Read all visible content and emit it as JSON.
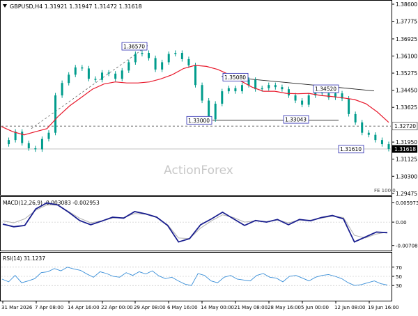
{
  "header": {
    "title": "GBPUSD,H4  1.31921 1.31947 1.31472 1.31618",
    "watermark": "ActionForex",
    "fe_label": "FE 100.0"
  },
  "colors": {
    "candle": "#009c8c",
    "ma": "#e8192c",
    "macd_line": "#1a1f8f",
    "macd_signal": "#b0b0b0",
    "rsi": "#3a8fd8",
    "trendline": "#222222",
    "dashed_trend": "#666666",
    "current_box": "#000000",
    "ref_box": "#555555",
    "level_box_border": "#2a2ab0",
    "grid": "#d8d8d8"
  },
  "chart_data": [
    {
      "type": "line",
      "name": "price",
      "title": "GBPUSD,H4  1.31921 1.31947 1.31472 1.31618",
      "ylim": [
        1.2947,
        1.386
      ],
      "yticks": [
        "1.38600",
        "1.37775",
        "1.36925",
        "1.36100",
        "1.35275",
        "1.34450",
        "1.33625",
        "1.32800",
        "1.31950",
        "1.31125",
        "1.30300",
        "1.29475"
      ],
      "x": [
        "31 Mar 2026",
        "7 Apr 08:00",
        "14 Apr 16:00",
        "22 Apr 00:00",
        "29 Apr 08:00",
        "6 May 16:00",
        "14 May 00:00",
        "21 May 08:00",
        "28 May 16:00",
        "5 Jun 00:00",
        "12 Jun 08:00",
        "19 Jun 16:00"
      ],
      "series": [
        {
          "values": [
            1.3185,
            1.3205,
            1.3245,
            1.319,
            1.3165,
            1.316,
            1.321,
            1.324,
            1.342,
            1.348,
            1.352,
            1.3555,
            1.355,
            1.35,
            1.3495,
            1.353,
            1.3525,
            1.35,
            1.354,
            1.358,
            1.362,
            1.3625,
            1.36,
            1.3545,
            1.358,
            1.362,
            1.3625,
            1.3595,
            1.3565,
            1.347,
            1.3395,
            1.3305,
            1.338,
            1.344,
            1.3455,
            1.344,
            1.347,
            1.3495,
            1.345,
            1.3455,
            1.347,
            1.346,
            1.345,
            1.342,
            1.3395,
            1.3375,
            1.342,
            1.345,
            1.343,
            1.341,
            1.343,
            1.3405,
            1.333,
            1.329,
            1.324,
            1.323,
            1.3205,
            1.3185,
            1.3162
          ]
        },
        {
          "values": [
            1.327,
            1.3245,
            1.323,
            1.3245,
            1.326,
            1.332,
            1.337,
            1.341,
            1.345,
            1.3475,
            1.3485,
            1.348,
            1.348,
            1.3485,
            1.35,
            1.352,
            1.355,
            1.3565,
            1.356,
            1.3545,
            1.352,
            1.349,
            1.346,
            1.344,
            1.344,
            1.343,
            1.3428,
            1.343,
            1.342,
            1.3415,
            1.3408,
            1.34,
            1.338,
            1.334,
            1.329
          ]
        }
      ],
      "annotations": [
        {
          "label": "1.36570",
          "value": 1.3657
        },
        {
          "label": "1.35080",
          "value": 1.3508
        },
        {
          "label": "1.34520",
          "value": 1.3452
        },
        {
          "label": "1.33000",
          "value": 1.33
        },
        {
          "label": "1.33043",
          "value": 1.33043
        },
        {
          "label": "1.31610",
          "value": 1.3161
        }
      ],
      "reference_levels": [
        {
          "label": "1.32720",
          "value": 1.3272,
          "style": "dashed"
        }
      ],
      "current_price": {
        "label": "1.31618",
        "value": 1.31618
      }
    },
    {
      "type": "line",
      "name": "macd",
      "title": "MACD(12,26,9) -0.003083 -0.002953",
      "ylim": [
        -0.0082,
        0.0072
      ],
      "yticks": [
        "0.005973",
        "0.00",
        "-0.007086"
      ],
      "series": [
        {
          "values": [
            -0.0006,
            -0.0014,
            -0.001,
            0.004,
            0.0058,
            0.0052,
            0.003,
            0.0005,
            -0.0008,
            0.0003,
            0.0015,
            0.0012,
            0.0032,
            0.0025,
            0.0015,
            -0.001,
            -0.006,
            -0.005,
            -0.0008,
            0.001,
            0.003,
            0.001,
            -0.001,
            0.0005,
            0.0,
            0.0008,
            -0.0008,
            0.0008,
            0.0004,
            0.0014,
            0.002,
            0.001,
            -0.006,
            -0.0045,
            -0.003,
            -0.0032
          ]
        },
        {
          "values": [
            0.0004,
            -0.0002,
            0.001,
            0.0036,
            0.0052,
            0.0052,
            0.0032,
            0.0012,
            -0.0002,
            0.0004,
            0.0012,
            0.0014,
            0.0026,
            0.0024,
            0.0014,
            -0.0008,
            -0.0048,
            -0.005,
            -0.0018,
            0.0004,
            0.0022,
            0.0014,
            0.0,
            0.0004,
            0.0002,
            0.0006,
            -0.0002,
            0.0006,
            0.0006,
            0.0012,
            0.0018,
            0.0014,
            -0.004,
            -0.0048,
            -0.0036,
            -0.003
          ]
        }
      ]
    },
    {
      "type": "line",
      "name": "rsi",
      "title": "RSI(14) 31.1237",
      "ylim": [
        0,
        100
      ],
      "yticks": [
        "70",
        "50",
        "30"
      ],
      "series": [
        {
          "values": [
            44,
            38,
            52,
            36,
            40,
            45,
            58,
            60,
            67,
            62,
            70,
            66,
            63,
            55,
            48,
            60,
            56,
            50,
            48,
            58,
            52,
            60,
            55,
            62,
            51,
            45,
            48,
            40,
            33,
            30,
            56,
            52,
            40,
            36,
            48,
            52,
            44,
            42,
            40,
            52,
            56,
            48,
            46,
            38,
            50,
            52,
            46,
            40,
            48,
            52,
            54,
            50,
            45,
            36,
            30,
            32,
            36,
            40,
            34,
            31
          ]
        }
      ]
    }
  ],
  "x_axis": {
    "labels": [
      "31 Mar 2026",
      "7 Apr 08:00",
      "14 Apr 16:00",
      "22 Apr 00:00",
      "29 Apr 08:00",
      "6 May 16:00",
      "14 May 00:00",
      "21 May 08:00",
      "28 May 16:00",
      "5 Jun 00:00",
      "12 Jun 08:00",
      "19 Jun 16:00"
    ]
  }
}
